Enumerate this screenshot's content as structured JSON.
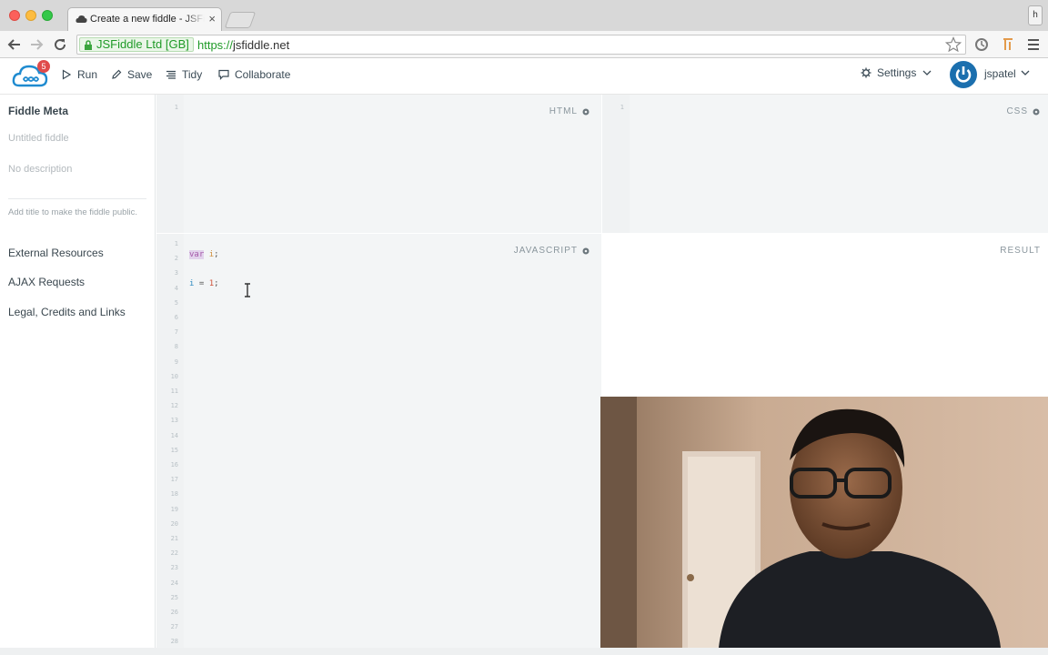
{
  "browser": {
    "tab_title": "Create a new fiddle - JSFiddle",
    "tab_close": "×",
    "profile_initial": "h",
    "security_label": "JSFiddle Ltd [GB]",
    "url_scheme": "https://",
    "url_host": "jsfiddle.net"
  },
  "header": {
    "notification_count": "5",
    "run": "Run",
    "save": "Save",
    "tidy": "Tidy",
    "collaborate": "Collaborate",
    "settings": "Settings",
    "username": "jspatel"
  },
  "sidebar": {
    "title": "Fiddle Meta",
    "title_placeholder": "Untitled fiddle",
    "description_placeholder": "No description",
    "hint": "Add title to make the fiddle public.",
    "links": [
      "External Resources",
      "AJAX Requests",
      "Legal, Credits and Links"
    ]
  },
  "panes": {
    "html_label": "HTML",
    "css_label": "CSS",
    "js_label": "JAVASCRIPT",
    "result_label": "RESULT"
  },
  "editor": {
    "html_lines": [
      "1"
    ],
    "css_lines": [
      "1"
    ],
    "js_lines": [
      "1",
      "2",
      "3",
      "4",
      "5",
      "6",
      "7",
      "8",
      "9",
      "10",
      "11",
      "12",
      "13",
      "14",
      "15",
      "16",
      "17",
      "18",
      "19",
      "20",
      "21",
      "22",
      "23",
      "24",
      "25",
      "26",
      "27",
      "28"
    ],
    "line2": {
      "keyword": "var",
      "name": "i",
      "end": ";"
    },
    "line4": {
      "name": "i",
      "op": " = ",
      "value": "1",
      "end": ";"
    }
  },
  "colors": {
    "accent_blue": "#1b6fae",
    "secure_green": "#1f9a27",
    "badge_red": "#e04b4b",
    "pane_bg": "#f3f5f6"
  },
  "icons": {
    "run": "play-icon",
    "save": "pencil-icon",
    "tidy": "lines-icon",
    "collaborate": "chat-icon",
    "settings": "gear-icon",
    "user": "power-icon"
  }
}
